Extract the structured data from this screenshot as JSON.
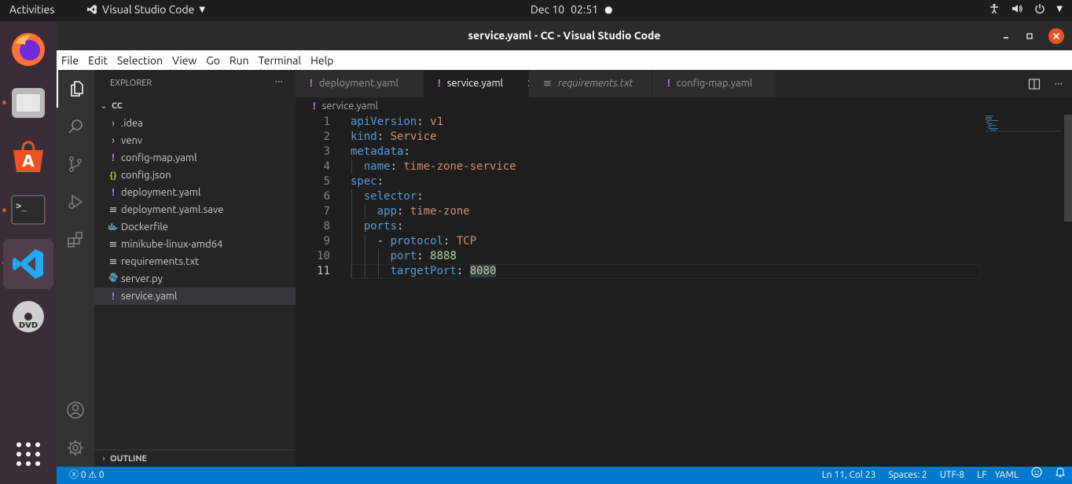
{
  "topbar": {
    "activities": "Activities",
    "app_name": "Visual Studio Code",
    "date": "Dec 10",
    "time": "02:51"
  },
  "window": {
    "title": "service.yaml - CC - Visual Studio Code"
  },
  "menu": [
    "File",
    "Edit",
    "Selection",
    "View",
    "Go",
    "Run",
    "Terminal",
    "Help"
  ],
  "explorer": {
    "header": "EXPLORER",
    "folder": "CC",
    "items": [
      {
        "label": ".idea",
        "icon": "chevron-right",
        "type": "folder"
      },
      {
        "label": "venv",
        "icon": "chevron-right",
        "type": "folder"
      },
      {
        "label": "config-map.yaml",
        "icon": "yaml",
        "type": "file"
      },
      {
        "label": "config.json",
        "icon": "json",
        "type": "file"
      },
      {
        "label": "deployment.yaml",
        "icon": "yaml",
        "type": "file"
      },
      {
        "label": "deployment.yaml.save",
        "icon": "text",
        "type": "file"
      },
      {
        "label": "Dockerfile",
        "icon": "docker",
        "type": "file"
      },
      {
        "label": "minikube-linux-amd64",
        "icon": "text",
        "type": "file"
      },
      {
        "label": "requirements.txt",
        "icon": "text",
        "type": "file"
      },
      {
        "label": "server.py",
        "icon": "python",
        "type": "file"
      },
      {
        "label": "service.yaml",
        "icon": "yaml",
        "type": "file",
        "selected": true
      }
    ],
    "outline": "OUTLINE"
  },
  "tabs": [
    {
      "label": "deployment.yaml",
      "icon": "yaml"
    },
    {
      "label": "service.yaml",
      "icon": "yaml",
      "active": true
    },
    {
      "label": "requirements.txt",
      "icon": "text",
      "italic": true
    },
    {
      "label": "config-map.yaml",
      "icon": "yaml"
    }
  ],
  "breadcrumb": "service.yaml",
  "code_lines": [
    {
      "n": "1",
      "text": "apiVersion: v1"
    },
    {
      "n": "2",
      "text": "kind: Service"
    },
    {
      "n": "3",
      "text": "metadata:"
    },
    {
      "n": "4",
      "text": "  name: time-zone-service"
    },
    {
      "n": "5",
      "text": "spec:"
    },
    {
      "n": "6",
      "text": "  selector:"
    },
    {
      "n": "7",
      "text": "    app: time-zone"
    },
    {
      "n": "8",
      "text": "  ports:"
    },
    {
      "n": "9",
      "text": "    - protocol: TCP"
    },
    {
      "n": "10",
      "text": "      port: 8888"
    },
    {
      "n": "11",
      "text": "      targetPort: 8080"
    }
  ],
  "status": {
    "errors": "0",
    "warnings": "0",
    "position": "Ln 11, Col 23",
    "spaces": "Spaces: 2",
    "encoding": "UTF-8",
    "eol": "LF",
    "language": "YAML"
  },
  "colors": {
    "statusbar": "#007acc",
    "dock": "#3a2d38",
    "accent": "#e95420"
  }
}
